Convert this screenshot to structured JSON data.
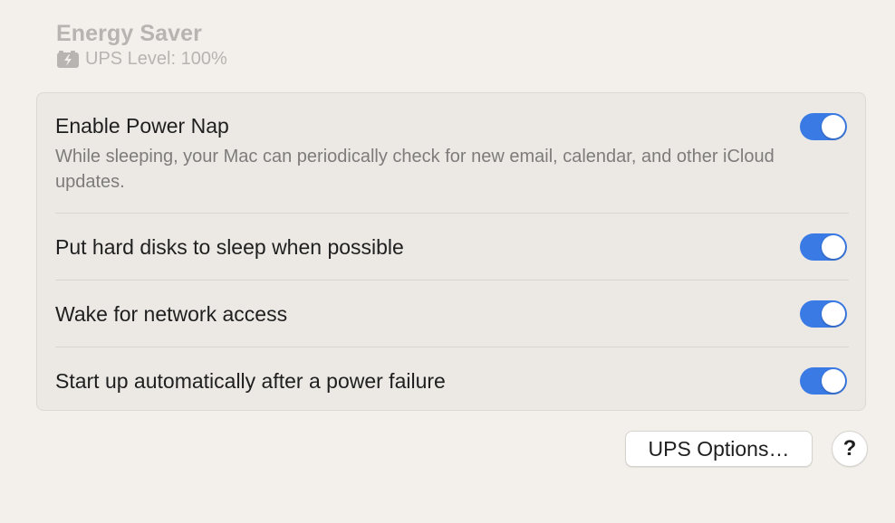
{
  "header": {
    "title": "Energy Saver",
    "ups_level": "UPS Level: 100%",
    "icon": "battery-charging-icon"
  },
  "settings": [
    {
      "title": "Enable Power Nap",
      "description": "While sleeping, your Mac can periodically check for new email, calendar, and other iCloud updates.",
      "enabled": true
    },
    {
      "title": "Put hard disks to sleep when possible",
      "enabled": true
    },
    {
      "title": "Wake for network access",
      "enabled": true
    },
    {
      "title": "Start up automatically after a power failure",
      "enabled": true
    }
  ],
  "buttons": {
    "ups_options": "UPS Options…",
    "help": "?"
  },
  "colors": {
    "toggle_on": "#3a7ae4",
    "background": "#f3f0eb",
    "panel": "#ece9e5"
  }
}
